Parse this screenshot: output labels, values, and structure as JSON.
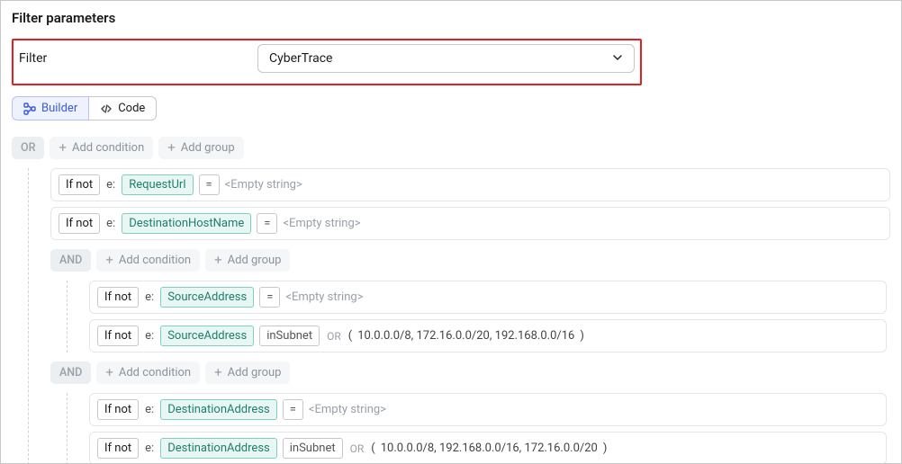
{
  "panelTitle": "Filter parameters",
  "filterRow": {
    "label": "Filter",
    "selected": "CyberTrace"
  },
  "tabs": {
    "builder": "Builder",
    "code": "Code"
  },
  "labels": {
    "addCondition": "Add condition",
    "addGroup": "Add group",
    "ifNot": "If not",
    "ePrefix": "e:",
    "emptyString": "<Empty string>",
    "or": "OR",
    "and": "AND",
    "orInline": "OR"
  },
  "root": {
    "op": "OR",
    "children": [
      {
        "kind": "cond",
        "ifNot": true,
        "field": "RequestUrl",
        "cmp": "=",
        "value": "<Empty string>"
      },
      {
        "kind": "cond",
        "ifNot": true,
        "field": "DestinationHostName",
        "cmp": "=",
        "value": "<Empty string>"
      },
      {
        "kind": "group",
        "op": "AND",
        "children": [
          {
            "kind": "cond",
            "ifNot": true,
            "field": "SourceAddress",
            "cmp": "=",
            "value": "<Empty string>"
          },
          {
            "kind": "cond",
            "ifNot": true,
            "field": "SourceAddress",
            "cmp": "inSubnet",
            "join": "OR",
            "args": "10.0.0.0/8, 172.16.0.0/20, 192.168.0.0/16"
          }
        ]
      },
      {
        "kind": "group",
        "op": "AND",
        "children": [
          {
            "kind": "cond",
            "ifNot": true,
            "field": "DestinationAddress",
            "cmp": "=",
            "value": "<Empty string>"
          },
          {
            "kind": "cond",
            "ifNot": true,
            "field": "DestinationAddress",
            "cmp": "inSubnet",
            "join": "OR",
            "args": "10.0.0.0/8, 192.168.0.0/16, 172.16.0.0/20"
          }
        ]
      }
    ]
  }
}
